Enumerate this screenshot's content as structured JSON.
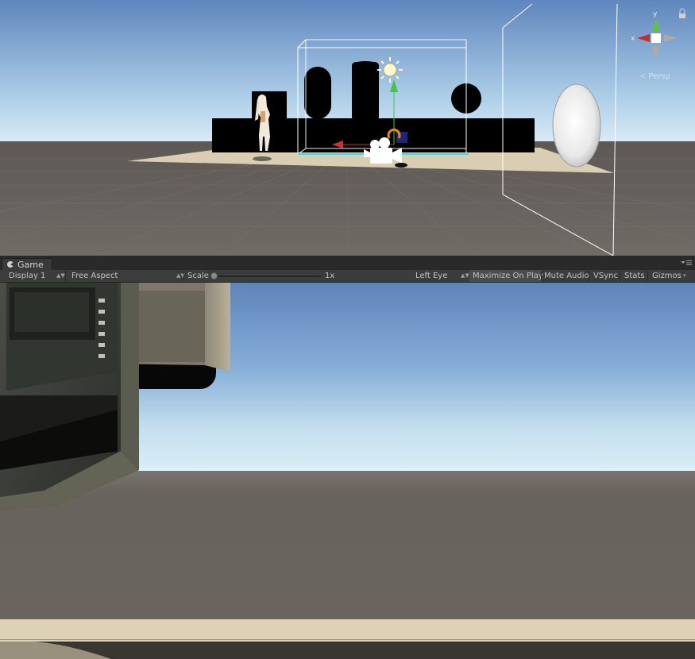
{
  "scene": {
    "gizmo_axes": {
      "x": "x",
      "y": "y"
    },
    "projection_label": "Persp",
    "icons": {
      "lock": "lock-icon",
      "sun": "directional-light-icon",
      "camera": "camera-gizmo-icon"
    }
  },
  "game_tab": {
    "label": "Game",
    "icon": "game-controller-icon",
    "menu_icon": "tab-menu-icon"
  },
  "toolbar": {
    "display": "Display 1",
    "aspect": "Free Aspect",
    "scale_label": "Scale",
    "scale_value": "1x",
    "scale_level": 0,
    "eye": "Left Eye",
    "maximize_on_play": "Maximize On Play",
    "mute_audio": "Mute Audio",
    "vsync": "VSync",
    "stats": "Stats",
    "gizmos": "Gizmos"
  },
  "colors": {
    "editor_bg": "#282828",
    "toolbar_bg": "#3c3c3c",
    "toggle_active": "#4b4b4b",
    "sky_top": "#5c82b8",
    "horizon": "#cde6f3",
    "ground": "#6b6560",
    "sand": "#ddd2b6"
  }
}
